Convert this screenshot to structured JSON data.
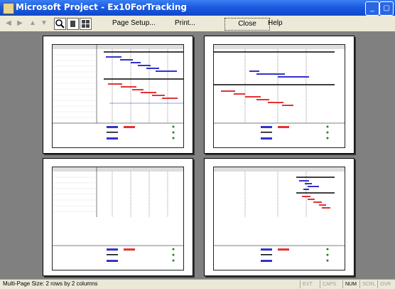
{
  "window": {
    "title": "Microsoft Project - Ex10ForTracking"
  },
  "toolbar": {
    "page_setup": "Page Setup...",
    "print": "Print...",
    "close": "Close",
    "help": "Help"
  },
  "status": {
    "text": "Multi-Page  Size: 2 rows by 2 columns",
    "ext": "EXT",
    "caps": "CAPS",
    "num": "NUM",
    "scrl": "SCRL",
    "ovr": "OVR"
  },
  "colors": {
    "titlebar": "#1c5be0",
    "workspace": "#808080",
    "planned_bar": "#3333cc",
    "critical_bar": "#e33333"
  },
  "icons": [
    "back-arrow",
    "forward-arrow",
    "up-arrow",
    "down-arrow",
    "zoom-icon",
    "single-page-icon",
    "multi-page-icon"
  ]
}
